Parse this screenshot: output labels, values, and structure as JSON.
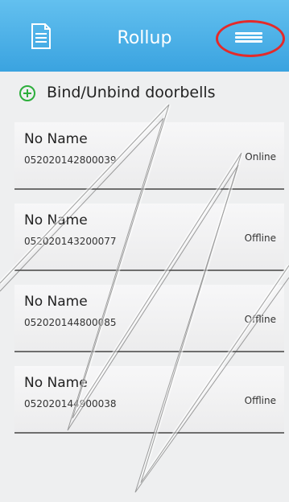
{
  "header": {
    "title": "Rollup",
    "left_icon": "document-icon",
    "menu_icon": "menu-icon",
    "background_color": "#4ab2e8"
  },
  "bind": {
    "label": "Bind/Unbind doorbells",
    "icon": "add-circle-icon",
    "icon_color": "#2cae3b"
  },
  "devices": [
    {
      "name": "No Name",
      "id": "052020142800039",
      "status": "Online"
    },
    {
      "name": "No Name",
      "id": "052020143200077",
      "status": "Offline"
    },
    {
      "name": "No Name",
      "id": "052020144800085",
      "status": "Offline"
    },
    {
      "name": "No Name",
      "id": "052020144900038",
      "status": "Offline"
    }
  ],
  "annotation": {
    "highlight_color": "#e42a2a"
  }
}
